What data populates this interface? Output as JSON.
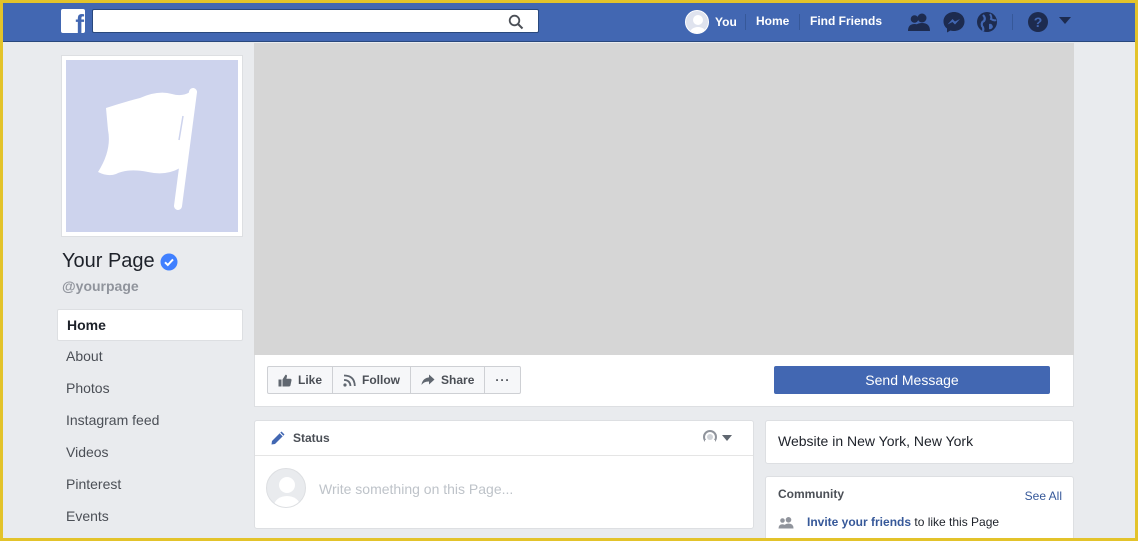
{
  "topbar": {
    "search_placeholder": "",
    "you_label": "You",
    "home_label": "Home",
    "find_friends_label": "Find Friends"
  },
  "page": {
    "name": "Your Page",
    "handle": "@yourpage"
  },
  "left_nav": {
    "items": [
      {
        "label": "Home",
        "active": true
      },
      {
        "label": "About"
      },
      {
        "label": "Photos"
      },
      {
        "label": "Instagram feed"
      },
      {
        "label": "Videos"
      },
      {
        "label": "Pinterest"
      },
      {
        "label": "Events"
      }
    ]
  },
  "actions": {
    "like": "Like",
    "follow": "Follow",
    "share": "Share",
    "more": "···",
    "send_message": "Send Message"
  },
  "composer": {
    "tab": "Status",
    "placeholder": "Write something on this Page..."
  },
  "right": {
    "website": "Website in New York, New York",
    "community_title": "Community",
    "see_all": "See All",
    "invite_link": "Invite your friends",
    "invite_rest": " to like this Page"
  },
  "colors": {
    "brand": "#4267b2",
    "frame": "#e3c32a",
    "cover": "#d6d6d6",
    "profile_bg": "#cdd3ed"
  }
}
